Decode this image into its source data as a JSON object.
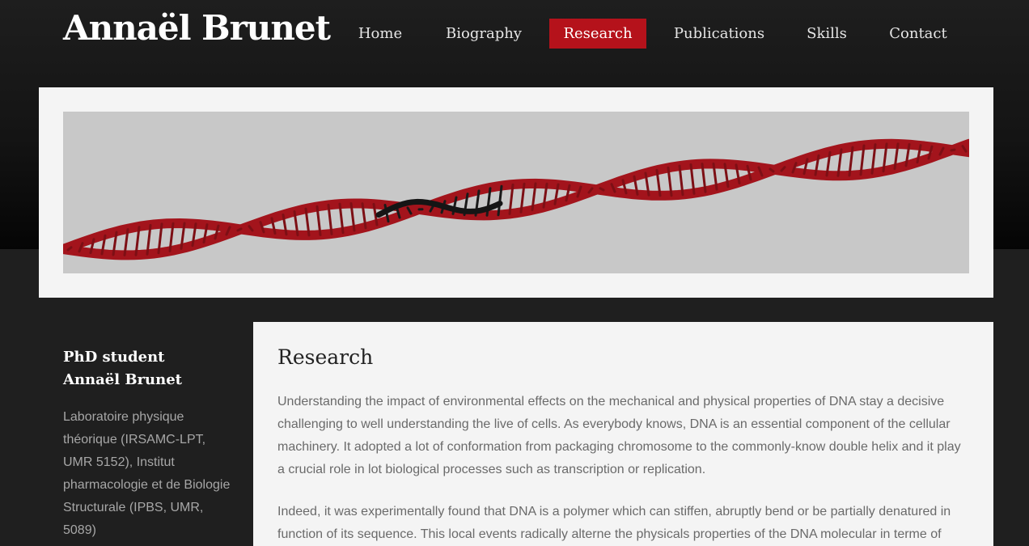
{
  "site": {
    "title": "Annaël Brunet"
  },
  "nav": {
    "items": [
      {
        "label": "Home",
        "active": false
      },
      {
        "label": "Biography",
        "active": false
      },
      {
        "label": "Research",
        "active": true
      },
      {
        "label": "Publications",
        "active": false
      },
      {
        "label": "Skills",
        "active": false
      },
      {
        "label": "Contact",
        "active": false
      }
    ]
  },
  "banner": {
    "image": "dna-double-helix-image"
  },
  "sidebar": {
    "title_line1": "PhD student",
    "title_line2": "Annaël Brunet",
    "affiliation": "Laboratoire physique théorique (IRSAMC-LPT, UMR 5152), Institut pharmacologie et de Biologie Structurale (IPBS, UMR, 5089)"
  },
  "main": {
    "title": "Research",
    "paragraphs": [
      "Understanding the impact of environmental effects on the mechanical and physical properties of DNA stay a decisive challenging to well understanding the live of cells. As everybody knows, DNA is an essential component of the cellular machinery. It adopted a lot of conformation from packaging chromosome to the commonly-know double helix and it play a crucial role in lot biological processes such as transcription or replication.",
      "Indeed, it was experimentally found that DNA is a polymer which can stiffen, abruptly bend or be partially denatured in function of its sequence. This local events radically alterne the physicals properties of the DNA molecular in terme of"
    ]
  },
  "colors": {
    "accent": "#b5121b",
    "background": "#1f1f1f",
    "panel": "#f4f4f4",
    "dna_red": "#a3141c"
  }
}
